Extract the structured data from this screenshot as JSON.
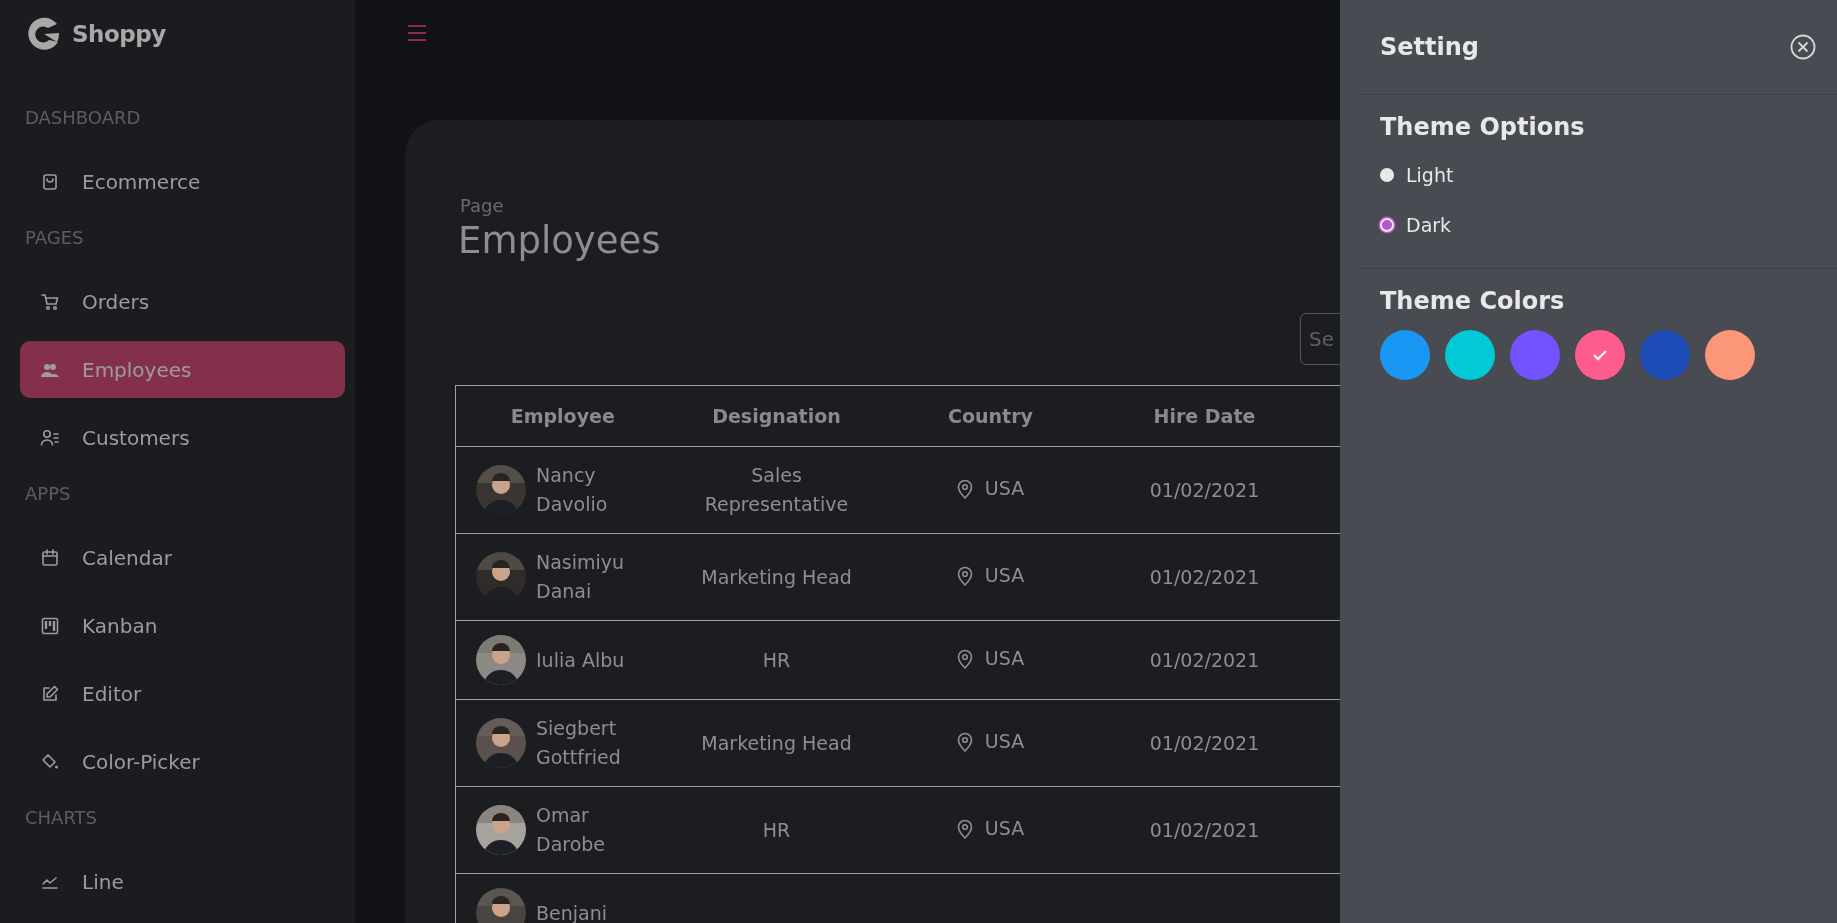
{
  "brand": "Shoppy",
  "sidebar": {
    "sections": [
      {
        "title": "DASHBOARD",
        "items": [
          {
            "label": "Ecommerce",
            "selected": false
          }
        ]
      },
      {
        "title": "PAGES",
        "items": [
          {
            "label": "Orders",
            "selected": false
          },
          {
            "label": "Employees",
            "selected": true
          },
          {
            "label": "Customers",
            "selected": false
          }
        ]
      },
      {
        "title": "APPS",
        "items": [
          {
            "label": "Calendar",
            "selected": false
          },
          {
            "label": "Kanban",
            "selected": false
          },
          {
            "label": "Editor",
            "selected": false
          },
          {
            "label": "Color-Picker",
            "selected": false
          }
        ]
      },
      {
        "title": "CHARTS",
        "items": [
          {
            "label": "Line",
            "selected": false
          }
        ]
      }
    ]
  },
  "page": {
    "breadcrumb": "Page",
    "title": "Employees"
  },
  "search": {
    "placeholder": "Se"
  },
  "table": {
    "columns": [
      "Employee",
      "Designation",
      "Country",
      "Hire Date"
    ],
    "rows": [
      {
        "employee": "Nancy Davolio",
        "designation": "Sales Representative",
        "country": "USA",
        "hire_date": "01/02/2021"
      },
      {
        "employee": "Nasimiyu Danai",
        "designation": "Marketing Head",
        "country": "USA",
        "hire_date": "01/02/2021"
      },
      {
        "employee": "Iulia Albu",
        "designation": "HR",
        "country": "USA",
        "hire_date": "01/02/2021"
      },
      {
        "employee": "Siegbert Gottfried",
        "designation": "Marketing Head",
        "country": "USA",
        "hire_date": "01/02/2021"
      },
      {
        "employee": "Omar Darobe",
        "designation": "HR",
        "country": "USA",
        "hire_date": "01/02/2021"
      },
      {
        "employee": "Benjani"
      }
    ]
  },
  "settings": {
    "title": "Setting",
    "theme_options": {
      "title": "Theme Options",
      "options": [
        {
          "label": "Light",
          "selected": false
        },
        {
          "label": "Dark",
          "selected": true
        }
      ]
    },
    "theme_colors": {
      "title": "Theme Colors",
      "colors": [
        {
          "color": "#1a97f5",
          "selected": false
        },
        {
          "color": "#03c9d7",
          "selected": false
        },
        {
          "color": "#7352ff",
          "selected": false
        },
        {
          "color": "#ff5c8e",
          "selected": true
        },
        {
          "color": "#1e4db7",
          "selected": false
        },
        {
          "color": "#fb9678",
          "selected": false
        }
      ]
    }
  }
}
